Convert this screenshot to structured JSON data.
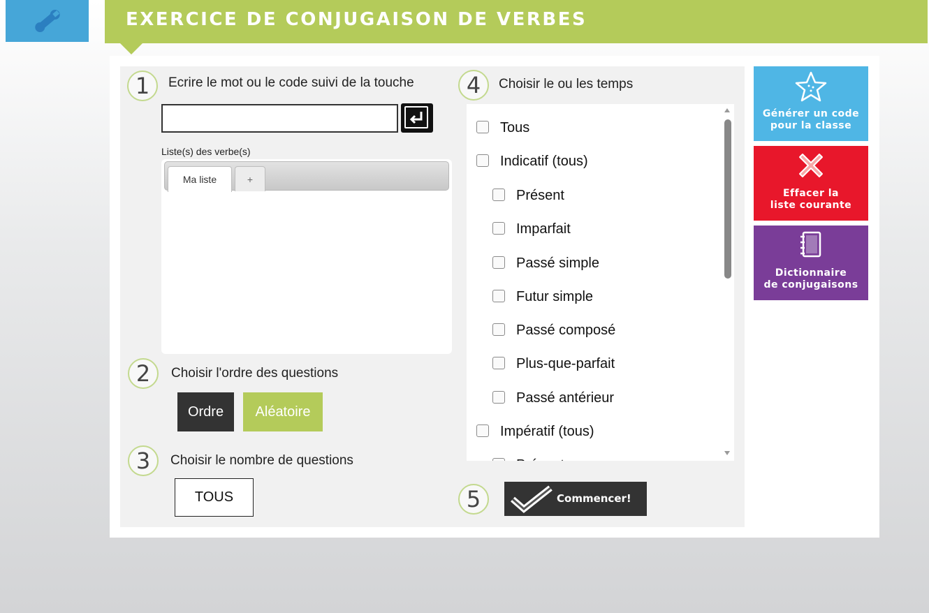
{
  "header": {
    "title": "EXERCICE DE CONJUGAISON DE VERBES",
    "logo_icon": "wrench-icon"
  },
  "steps": [
    {
      "number": "1",
      "label": "Ecrire le mot ou le code suivi de la touche"
    },
    {
      "number": "2",
      "label": "Choisir l'ordre des questions"
    },
    {
      "number": "3",
      "label": "Choisir le nombre de questions"
    },
    {
      "number": "4",
      "label": "Choisir le ou les temps"
    },
    {
      "number": "5"
    }
  ],
  "word_input": {
    "value": "",
    "enter_icon": "enter-key-icon"
  },
  "verb_lists": {
    "caption": "Liste(s) des verbe(s)",
    "tabs": [
      {
        "label": "Ma liste"
      },
      {
        "label": "+"
      }
    ]
  },
  "order": {
    "ordered_label": "Ordre",
    "random_label": "Aléatoire",
    "selected": "Aléatoire"
  },
  "question_count": {
    "value": "TOUS"
  },
  "tenses": [
    {
      "label": "Tous",
      "checked": false
    },
    {
      "label": "Indicatif (tous)",
      "checked": false
    },
    {
      "label": "Présent",
      "checked": false
    },
    {
      "label": "Imparfait",
      "checked": false
    },
    {
      "label": "Passé simple",
      "checked": false
    },
    {
      "label": "Futur simple",
      "checked": false
    },
    {
      "label": "Passé composé",
      "checked": false
    },
    {
      "label": "Plus-que-parfait",
      "checked": false
    },
    {
      "label": "Passé antérieur",
      "checked": false
    },
    {
      "label": "Impératif (tous)",
      "checked": false
    },
    {
      "label": "Présent",
      "checked": false
    }
  ],
  "start_button": {
    "label": "Commencer!"
  },
  "side_buttons": {
    "code": {
      "line1": "Générer un code",
      "line2": "pour la classe",
      "color": "#4fb6e5",
      "icon": "star-icon"
    },
    "clear": {
      "line1": "Effacer la",
      "line2": "liste courante",
      "color": "#e8172b",
      "icon": "cross-icon"
    },
    "dictionary": {
      "line1": "Dictionnaire",
      "line2": "de conjugaisons",
      "color": "#7a3d98",
      "icon": "book-icon"
    }
  },
  "colors": {
    "accent_green": "#b4cb5a",
    "logo_blue": "#46a6d8",
    "dark": "#333333"
  }
}
